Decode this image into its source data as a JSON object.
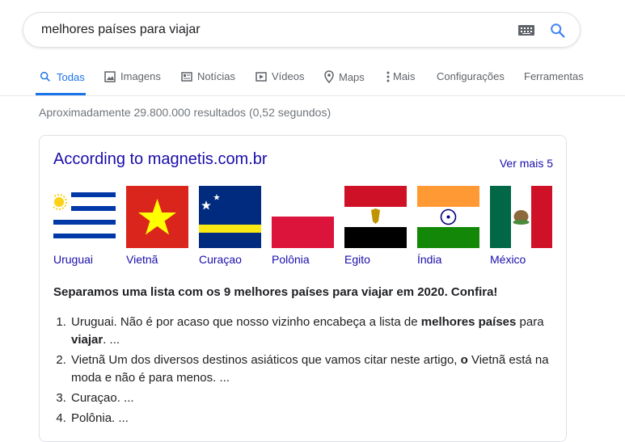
{
  "search": {
    "query": "melhores países para viajar"
  },
  "tabs": [
    {
      "label": "Todas"
    },
    {
      "label": "Imagens"
    },
    {
      "label": "Notícias"
    },
    {
      "label": "Vídeos"
    },
    {
      "label": "Maps"
    },
    {
      "label": "Mais"
    },
    {
      "label": "Configurações"
    },
    {
      "label": "Ferramentas"
    }
  ],
  "results_stats": "Aproximadamente 29.800.000 resultados (0,52 segundos)",
  "featured": {
    "title": "According to magnetis.com.br",
    "see_more": "Ver mais 5",
    "countries": [
      {
        "label": "Uruguai"
      },
      {
        "label": "Vietnã"
      },
      {
        "label": "Curaçao"
      },
      {
        "label": "Polônia"
      },
      {
        "label": "Egito"
      },
      {
        "label": "Índia"
      },
      {
        "label": "México"
      }
    ],
    "heading": "Separamos uma lista com os 9 melhores países para viajar em 2020. Confira!",
    "items": [
      {
        "html": "Uruguai. Não é por acaso que nosso vizinho encabeça a lista de <b>melhores países</b> para <b>viajar</b>. ..."
      },
      {
        "html": "Vietnã Um dos diversos destinos asiáticos que vamos citar neste artigo, <b>o</b> Vietnã está na moda e não é para menos. ..."
      },
      {
        "html": "Curaçao. ..."
      },
      {
        "html": "Polônia. ..."
      }
    ]
  },
  "colors": {
    "link": "#1a0dab",
    "accent": "#1a73e8",
    "muted": "#70757a"
  }
}
